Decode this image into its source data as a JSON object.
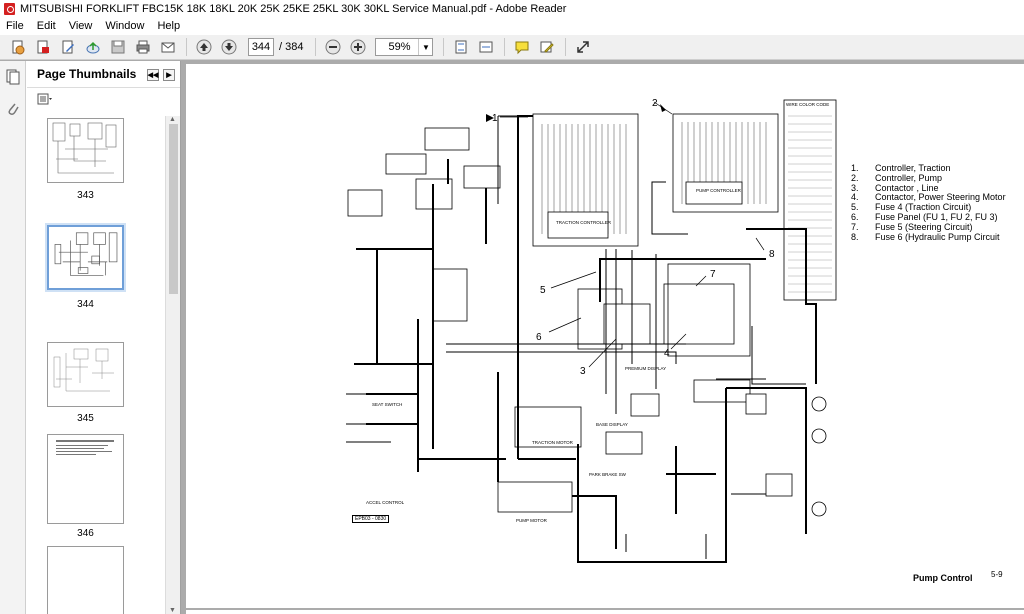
{
  "window": {
    "title": "MITSUBISHI FORKLIFT FBC15K 18K 18KL 20K 25K 25KE 25KL 30K 30KL  Service Manual.pdf - Adobe Reader"
  },
  "menu": {
    "file": "File",
    "edit": "Edit",
    "view": "View",
    "window": "Window",
    "help": "Help"
  },
  "toolbar": {
    "page_current": "344",
    "page_total": "/ 384",
    "zoom": "59%"
  },
  "sidebar": {
    "title": "Page Thumbnails",
    "thumbnails": [
      {
        "label": "343",
        "selected": false
      },
      {
        "label": "344",
        "selected": true
      },
      {
        "label": "345",
        "selected": false
      },
      {
        "label": "346",
        "selected": false
      }
    ]
  },
  "document": {
    "legend": [
      {
        "num": "1.",
        "text": "Controller, Traction"
      },
      {
        "num": "2.",
        "text": "Controller, Pump"
      },
      {
        "num": "3.",
        "text": "Contactor , Line"
      },
      {
        "num": "4.",
        "text": "Contactor, Power Steering Motor"
      },
      {
        "num": "5.",
        "text": "Fuse 4 (Traction Circuit)"
      },
      {
        "num": "6.",
        "text": "Fuse Panel (FU 1, FU 2, FU 3)"
      },
      {
        "num": "7.",
        "text": "Fuse 5 (Steering Circuit)"
      },
      {
        "num": "8.",
        "text": "Fuse 6 (Hydraulic Pump Circuit"
      }
    ],
    "callouts": {
      "c1": "1",
      "c2": "2",
      "c3": "3",
      "c4": "4",
      "c5": "5",
      "c6": "6",
      "c7": "7",
      "c8": "8"
    },
    "page_title": "Pump Control",
    "page_number": "5-9",
    "small_labels": {
      "traction_controller": "TRACTION CONTROLLER",
      "pump_controller": "PUMP CONTROLLER",
      "premium_display": "PREMIUM DISPLAY",
      "base_display": "BASE DISPLAY",
      "traction_motor": "TRACTION MOTOR",
      "pump_motor": "PUMP MOTOR",
      "park_brake_sw": "PARK BRAKE SW",
      "seat_switch": "SEAT SWITCH",
      "accel_control": "ACCEL CONTROL",
      "wiring_code": "WIRE COLOR CODE",
      "drawing_id": "EPB03 - 0830"
    }
  }
}
